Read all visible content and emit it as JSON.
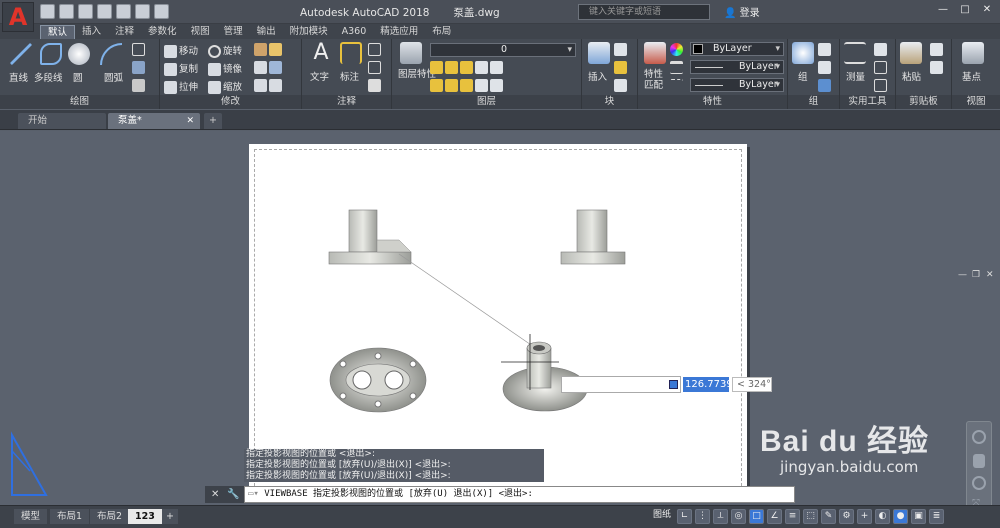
{
  "app": {
    "title": "Autodesk AutoCAD 2018",
    "file": "泵盖.dwg",
    "search_placeholder": "键入关键字或短语",
    "user": "登录"
  },
  "ribbon_tabs": [
    "默认",
    "插入",
    "注释",
    "参数化",
    "视图",
    "管理",
    "输出",
    "附加模块",
    "A360",
    "精选应用",
    "布局"
  ],
  "active_tab": "默认",
  "panels": {
    "draw": "绘图",
    "modify": "修改",
    "annotation": "注释",
    "layers": "图层",
    "block": "块",
    "properties": "特性",
    "groups": "组",
    "utilities": "实用工具",
    "clipboard": "剪贴板",
    "view": "视图"
  },
  "draw_tools": [
    "直线",
    "多段线",
    "圆",
    "圆弧"
  ],
  "modify_tools": [
    "移动",
    "旋转",
    "复制",
    "镜像",
    "拉伸",
    "缩放"
  ],
  "annot_tools": [
    "文字",
    "标注"
  ],
  "layer_tools": [
    "图层特性"
  ],
  "layer_value": "0",
  "block_tool": "插入",
  "prop_tool": "特性匹配",
  "bylayer": [
    "ByLayer",
    "ByLayer",
    "ByLayer"
  ],
  "group_tool": "组",
  "util_tool": "测量",
  "clip_tool": "粘贴",
  "view_tool": "基点",
  "doc_tabs": {
    "start": "开始",
    "file": "泵盖*"
  },
  "dynamic_input": {
    "value": "126.7739",
    "angle": "< 324°"
  },
  "command_history": [
    "指定投影视图的位置或 <退出>:",
    "指定投影视图的位置或 [放弃(U)/退出(X)] <退出>:",
    "指定投影视图的位置或 [放弃(U)/退出(X)] <退出>:"
  ],
  "command_line": "VIEWBASE 指定投影视图的位置或 [放弃(U) 退出(X)] <退出>:",
  "layout_tabs": [
    "模型",
    "布局1",
    "布局2",
    "123"
  ],
  "active_layout": "123",
  "status": {
    "paper": "图纸"
  },
  "watermark": {
    "brand": "Bai du 经验",
    "url": "jingyan.baidu.com"
  }
}
